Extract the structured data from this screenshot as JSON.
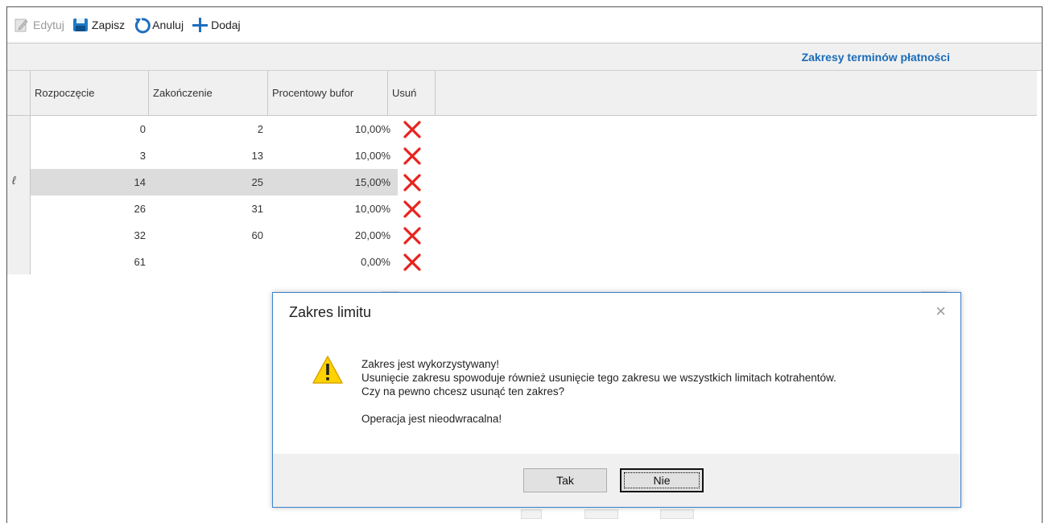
{
  "toolbar": {
    "edit_label": "Edytuj",
    "save_label": "Zapisz",
    "cancel_label": "Anuluj",
    "add_label": "Dodaj"
  },
  "section": {
    "title": "Zakresy terminów płatności"
  },
  "grid": {
    "columns": [
      "Rozpoczęcie",
      "Zakończenie",
      "Procentowy bufor",
      "Usuń"
    ],
    "rows": [
      {
        "start": "0",
        "end": "2",
        "buffer": "10,00%"
      },
      {
        "start": "3",
        "end": "13",
        "buffer": "10,00%"
      },
      {
        "start": "14",
        "end": "25",
        "buffer": "15,00%"
      },
      {
        "start": "26",
        "end": "31",
        "buffer": "10,00%"
      },
      {
        "start": "32",
        "end": "60",
        "buffer": "20,00%"
      },
      {
        "start": "61",
        "end": "",
        "buffer": "0,00%"
      }
    ],
    "selected_row_index": 2,
    "edit_indicator": "ℓ"
  },
  "dialog": {
    "title": "Zakres limitu",
    "close_glyph": "×",
    "line1": "Zakres jest wykorzystywany!",
    "line2": "Usunięcie zakresu spowoduje również usunięcie tego zakresu we wszystkich limitach kotrahentów.",
    "line3": "Czy na pewno chcesz usunąć ten zakres?",
    "line4": "Operacja jest nieodwracalna!",
    "yes_label": "Tak",
    "no_label": "Nie"
  },
  "colors": {
    "accent": "#1a6cb8",
    "delete_red": "#e8231e",
    "warning_yellow": "#ffd200",
    "dialog_border": "#3b82c9"
  }
}
